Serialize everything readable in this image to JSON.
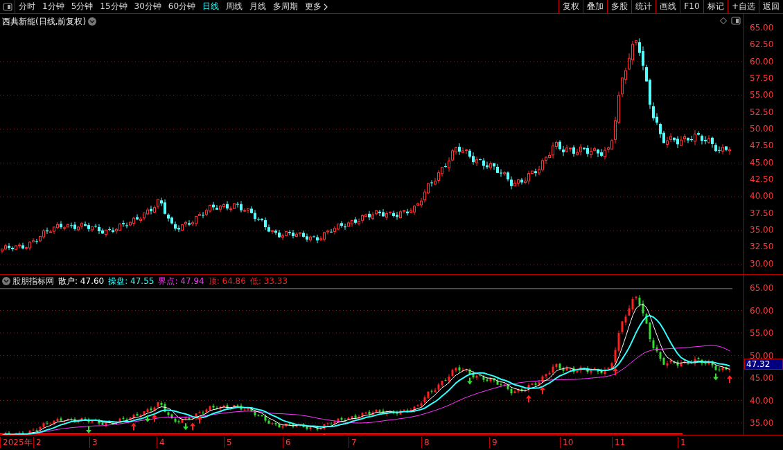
{
  "toolbar": {
    "periods": [
      {
        "label": "分时",
        "selected": false
      },
      {
        "label": "1分钟",
        "selected": false
      },
      {
        "label": "5分钟",
        "selected": false
      },
      {
        "label": "15分钟",
        "selected": false
      },
      {
        "label": "30分钟",
        "selected": false
      },
      {
        "label": "60分钟",
        "selected": false
      },
      {
        "label": "日线",
        "selected": true
      },
      {
        "label": "周线",
        "selected": false
      },
      {
        "label": "月线",
        "selected": false
      },
      {
        "label": "多周期",
        "selected": false
      }
    ],
    "more": "更多",
    "actions": [
      "复权",
      "叠加",
      "多股",
      "统计",
      "画线",
      "F10",
      "标记",
      "+自选",
      "返回"
    ]
  },
  "main_chart": {
    "title": "西典新能(日线,前复权)",
    "y_ticks": [
      "65.00",
      "62.50",
      "60.00",
      "57.50",
      "55.00",
      "52.50",
      "50.00",
      "47.50",
      "45.00",
      "42.50",
      "40.00",
      "37.50",
      "35.00",
      "32.50",
      "30.00"
    ]
  },
  "indicator": {
    "name": "股朋指标网",
    "values": [
      {
        "label": "散户:",
        "value": "47.60",
        "color": "#ffffff"
      },
      {
        "label": "操盘:",
        "value": "47.55",
        "color": "#33ffff"
      },
      {
        "label": "界点:",
        "value": "47.94",
        "color": "#ff33ff"
      },
      {
        "label": "顶:",
        "value": "64.86",
        "color": "#ff2020"
      },
      {
        "label": "低:",
        "value": "33.33",
        "color": "#ff2020"
      }
    ],
    "y_ticks": [
      "65.00",
      "60.00",
      "55.00",
      "50.00",
      "45.00",
      "40.00",
      "35.00"
    ],
    "last_value": "47.32"
  },
  "x_axis": {
    "labels": [
      "2025年",
      "2",
      "3",
      "4",
      "5",
      "6",
      "7",
      "8",
      "9",
      "10",
      "11",
      "1"
    ]
  }
}
